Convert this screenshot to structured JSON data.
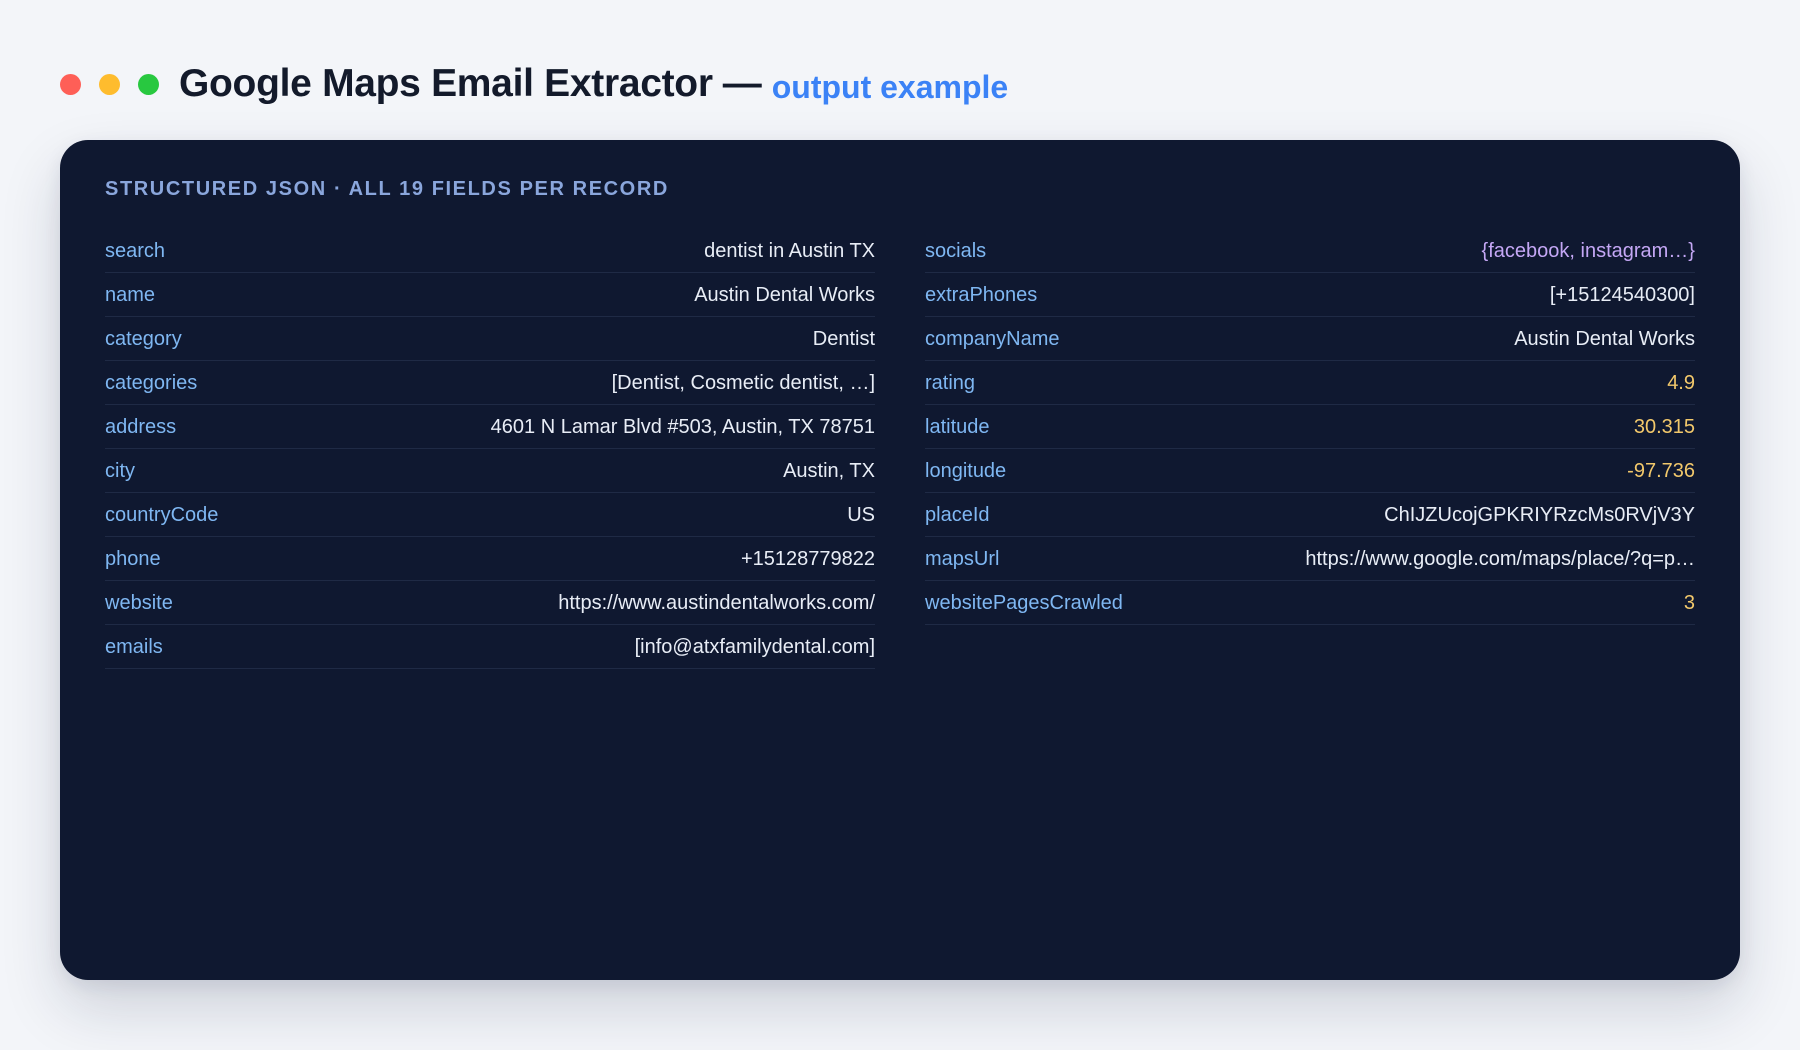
{
  "header": {
    "title": "Google Maps Email Extractor",
    "dash": "—",
    "subtitle": "output example",
    "window_dots": [
      {
        "name": "close",
        "color": "#fe5f57"
      },
      {
        "name": "minimize",
        "color": "#febc2e"
      },
      {
        "name": "maximize",
        "color": "#28c840"
      }
    ]
  },
  "card": {
    "heading": "STRUCTURED JSON · ALL 19 FIELDS PER RECORD",
    "left_fields": [
      {
        "key": "search",
        "value": "dentist in Austin TX",
        "type": "string"
      },
      {
        "key": "name",
        "value": "Austin Dental Works",
        "type": "string"
      },
      {
        "key": "category",
        "value": "Dentist",
        "type": "string"
      },
      {
        "key": "categories",
        "value": "[Dentist, Cosmetic dentist, …]",
        "type": "string"
      },
      {
        "key": "address",
        "value": "4601 N Lamar Blvd #503, Austin, TX 78751",
        "type": "string"
      },
      {
        "key": "city",
        "value": "Austin, TX",
        "type": "string"
      },
      {
        "key": "countryCode",
        "value": "US",
        "type": "string"
      },
      {
        "key": "phone",
        "value": "+15128779822",
        "type": "string"
      },
      {
        "key": "website",
        "value": "https://www.austindentalworks.com/",
        "type": "string"
      },
      {
        "key": "emails",
        "value": "[info@atxfamilydental.com]",
        "type": "string"
      }
    ],
    "right_fields": [
      {
        "key": "socials",
        "value": "{facebook, instagram…}",
        "type": "object"
      },
      {
        "key": "extraPhones",
        "value": "[+15124540300]",
        "type": "string"
      },
      {
        "key": "companyName",
        "value": "Austin Dental Works",
        "type": "string"
      },
      {
        "key": "rating",
        "value": "4.9",
        "type": "number"
      },
      {
        "key": "latitude",
        "value": "30.315",
        "type": "number"
      },
      {
        "key": "longitude",
        "value": "-97.736",
        "type": "number"
      },
      {
        "key": "placeId",
        "value": "ChIJZUcojGPKRIYRzcMs0RVjV3Y",
        "type": "string"
      },
      {
        "key": "mapsUrl",
        "value": "https://www.google.com/maps/place/?q=p…",
        "type": "string"
      },
      {
        "key": "websitePagesCrawled",
        "value": "3",
        "type": "number"
      }
    ]
  }
}
